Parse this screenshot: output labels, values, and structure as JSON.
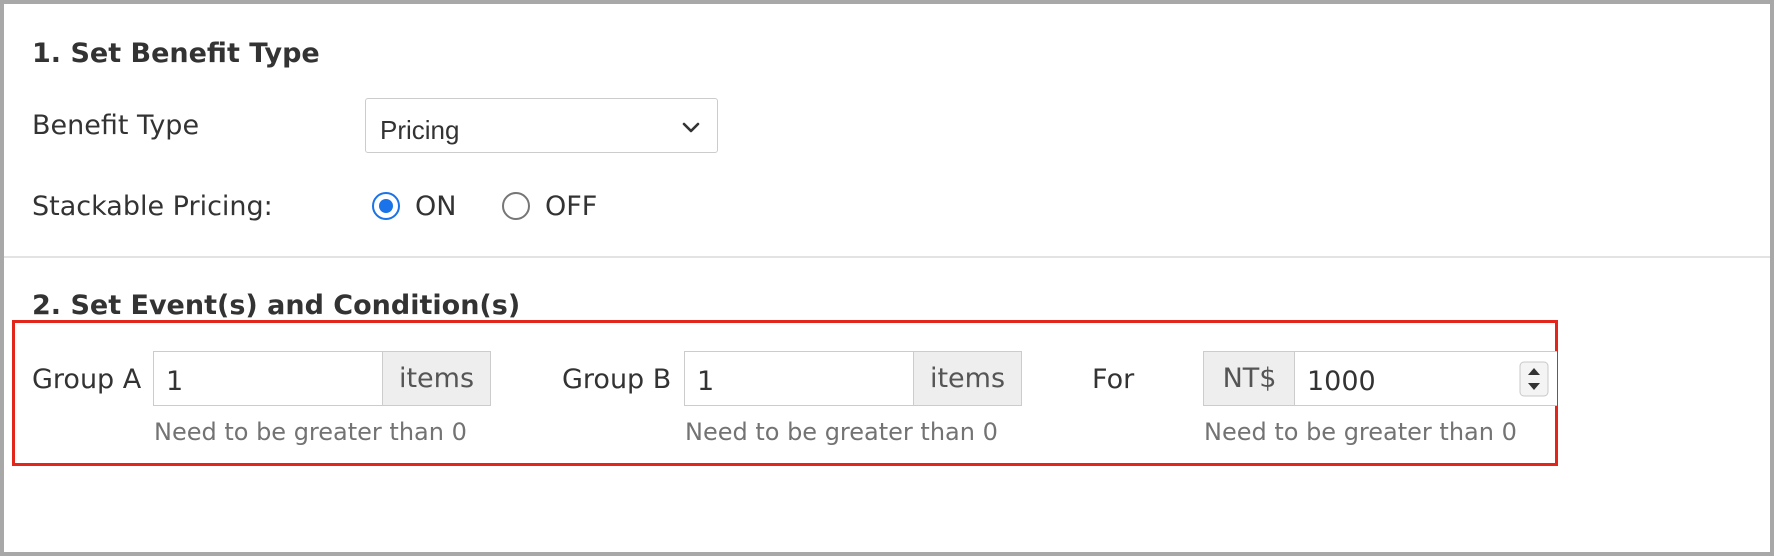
{
  "section1": {
    "title": "1. Set Benefit Type",
    "benefit_type_label": "Benefit Type",
    "benefit_type_value": "Pricing",
    "stackable_label": "Stackable Pricing:",
    "stackable_options": [
      {
        "label": "ON",
        "checked": true
      },
      {
        "label": "OFF",
        "checked": false
      }
    ]
  },
  "section2": {
    "title": "2. Set Event(s) and Condition(s)",
    "group_a": {
      "label": "Group A",
      "value": "1",
      "unit": "items",
      "help": "Need to be greater than 0"
    },
    "group_b": {
      "label": "Group B",
      "value": "1",
      "unit": "items",
      "help": "Need to be greater than 0"
    },
    "for": {
      "label": "For",
      "currency": "NT$",
      "value": "1000",
      "help": "Need to be greater than 0"
    }
  },
  "colors": {
    "accent": "#1a73e8",
    "highlight_border": "#e3261b",
    "addon_bg": "#eeeeee"
  },
  "icons": {
    "select_arrow": "chevron-down-icon",
    "number_spinner": "spinner-arrows-icon"
  }
}
